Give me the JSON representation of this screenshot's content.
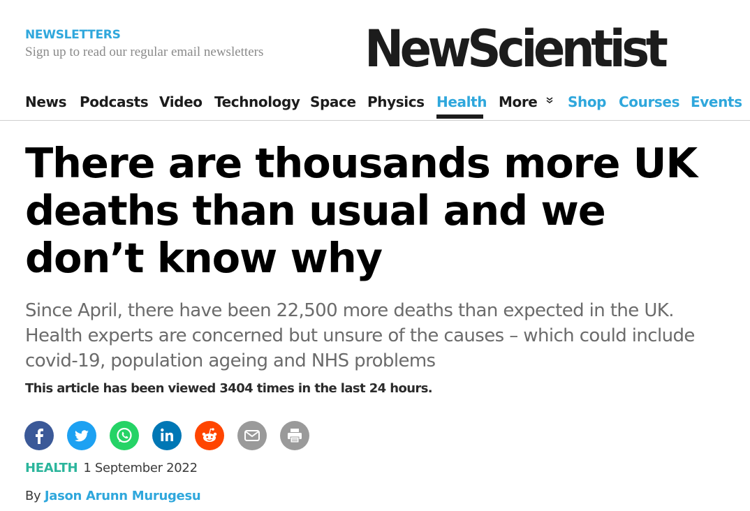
{
  "header": {
    "newsletters_title": "NEWSLETTERS",
    "newsletters_sub": "Sign up to read our regular email newsletters",
    "logo_text": "NewScientist"
  },
  "nav": {
    "items": [
      {
        "label": "News"
      },
      {
        "label": "Podcasts"
      },
      {
        "label": "Video"
      },
      {
        "label": "Technology"
      },
      {
        "label": "Space"
      },
      {
        "label": "Physics"
      },
      {
        "label": "Health",
        "active": true
      },
      {
        "label": "More"
      },
      {
        "label": "Shop"
      },
      {
        "label": "Courses"
      },
      {
        "label": "Events"
      }
    ]
  },
  "article": {
    "headline": "There are thousands more UK deaths than usual and we don’t know why",
    "standfirst": "Since April, there have been 22,500 more deaths than expected in the UK. Health experts are concerned but unsure of the causes – which could include covid-19, population ageing and NHS problems",
    "views_text": "This article has been viewed 3404 times in the last 24 hours.",
    "category": "HEALTH",
    "date": "1 September 2022",
    "by_prefix": "By",
    "author": "Jason Arunn Murugesu"
  },
  "share": [
    {
      "icon": "facebook-icon",
      "color": "#3b5998"
    },
    {
      "icon": "twitter-icon",
      "color": "#1da1f2"
    },
    {
      "icon": "whatsapp-icon",
      "color": "#25d366"
    },
    {
      "icon": "linkedin-icon",
      "color": "#0077b5"
    },
    {
      "icon": "reddit-icon",
      "color": "#ff4500"
    },
    {
      "icon": "email-icon",
      "color": "#9a9a9a"
    },
    {
      "icon": "print-icon",
      "color": "#9a9a9a"
    }
  ],
  "colors": {
    "accent_blue": "#2fa7dc",
    "category_green": "#2bb59c",
    "text_dark": "#1c1c1c"
  }
}
